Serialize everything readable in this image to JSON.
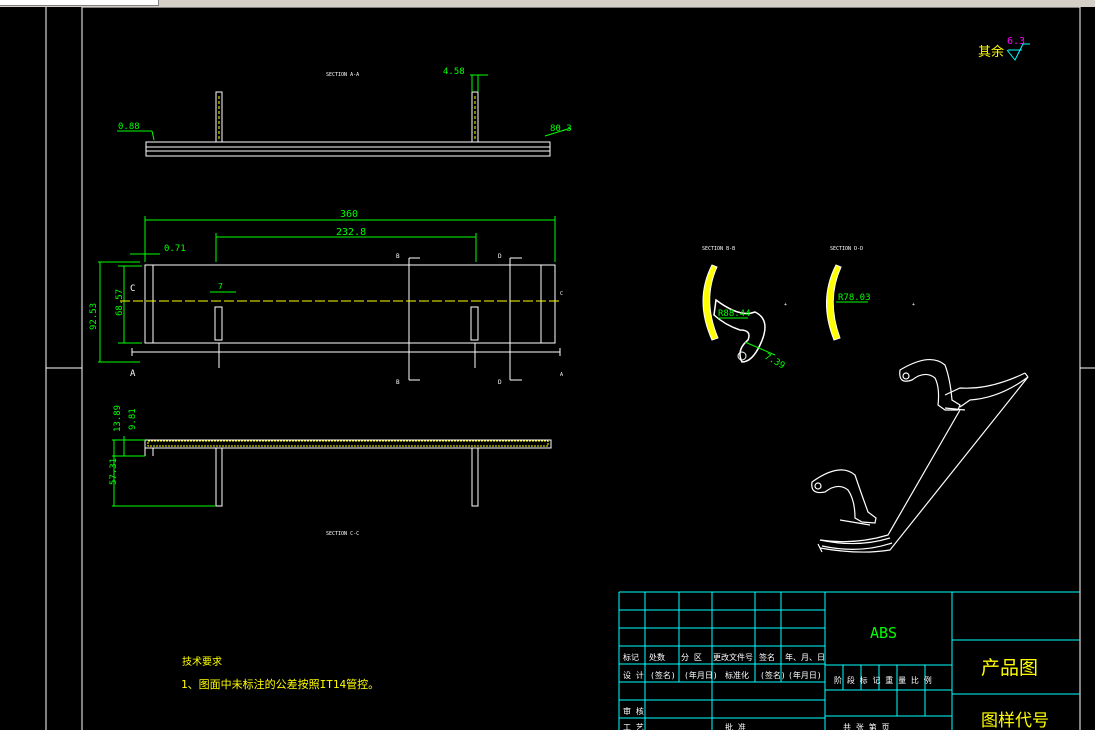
{
  "window": {
    "tab_label": ""
  },
  "colors": {
    "background": "#000000",
    "geometry": "#ffffff",
    "dimension": "#00ff00",
    "hatch": "#ffff00",
    "cyan": "#00ffff",
    "magenta": "#ff00ff",
    "frame": "#ffffff"
  },
  "sections": {
    "a": "SECTION A-A",
    "bb": "SECTION B-B",
    "cc": "SECTION C-C",
    "dd": "SECTION D-D"
  },
  "dims": {
    "d_088": "0.88",
    "d_458": "4.58",
    "d_803": "80.3",
    "d_360": "360",
    "d_2328": "232.8",
    "d_071": "0.71",
    "d_7": "7",
    "d_9253": "92.53",
    "d_6857": "68.57",
    "d_1389": "13.89",
    "d_981": "9.81",
    "d_5731": "57.31",
    "d_r8844": "R88.44",
    "d_739": "7.39",
    "d_r7803": "R78.03"
  },
  "markers": {
    "c": "C",
    "a": "A",
    "b": "B",
    "d": "D"
  },
  "roughness": {
    "label": "其余",
    "value": "6.3"
  },
  "notes": {
    "title": "技术要求",
    "line1": "1、图面中未标注的公差按照IT14管控。"
  },
  "title_block": {
    "material": "ABS",
    "product": "产品图",
    "code_label": "图样代号",
    "row_marks": [
      "标记",
      "处数",
      "分 区",
      "更改文件号",
      "签名",
      "年、月、日"
    ],
    "row_design": [
      "设 计",
      "(签名)",
      "(年月日)",
      "标准化",
      "(签名)",
      "(年月日)"
    ],
    "stage_row": "阶 段 标 记  重 量  比 例",
    "review": "审 核",
    "process": "工 艺",
    "approve": "批 准",
    "sheets": "共   张   第   页"
  }
}
